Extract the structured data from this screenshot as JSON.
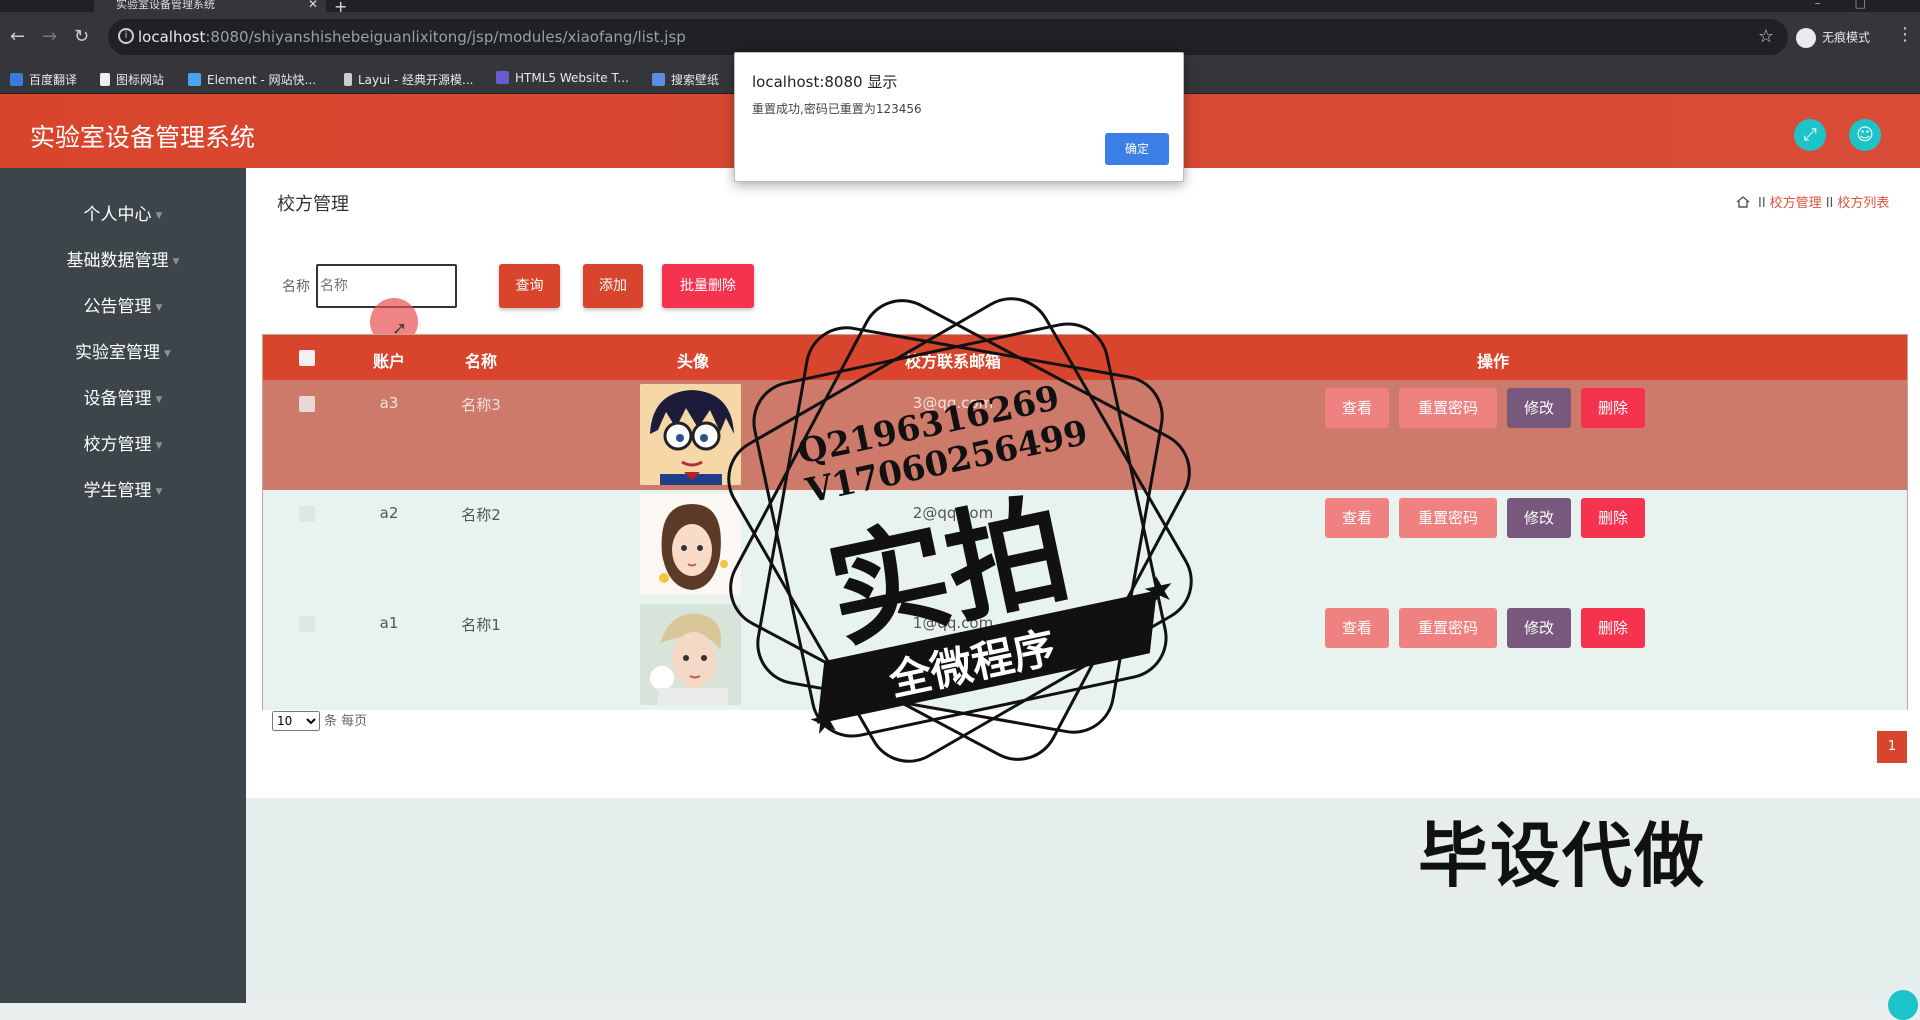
{
  "browser": {
    "tab_title": "实验室设备管理系统",
    "new_tab": "+",
    "url_host": "localhost",
    "url_rest": ":8080/shiyanshishebeiguanlixitong/jsp/modules/xiaofang/list.jsp",
    "incognito_label": "无痕模式",
    "bookmarks": [
      "百度翻译",
      "图标网站",
      "Element - 网站快...",
      "Layui - 经典开源模...",
      "HTML5 Website T...",
      "搜索壁纸"
    ]
  },
  "alert": {
    "title": "localhost:8080 显示",
    "message": "重置成功,密码已重置为123456",
    "ok_label": "确定"
  },
  "header": {
    "title": "实验室设备管理系统"
  },
  "sidebar": {
    "items": [
      "个人中心",
      "基础数据管理",
      "公告管理",
      "实验室管理",
      "设备管理",
      "校方管理",
      "学生管理"
    ]
  },
  "page": {
    "title": "校方管理",
    "breadcrumb": [
      "校方管理",
      "校方列表"
    ]
  },
  "search": {
    "label": "名称",
    "placeholder": "名称",
    "query_label": "查询",
    "add_label": "添加",
    "bulk_delete_label": "批量删除"
  },
  "table": {
    "headers": [
      "账户",
      "名称",
      "头像",
      "校方联系邮箱",
      "操作"
    ],
    "rows": [
      {
        "account": "a3",
        "name": "名称3",
        "email": "3@qq.com"
      },
      {
        "account": "a2",
        "name": "名称2",
        "email": "2@qq.com"
      },
      {
        "account": "a1",
        "name": "名称1",
        "email": "1@qq.com"
      }
    ],
    "actions": {
      "view": "查看",
      "reset": "重置密码",
      "edit": "修改",
      "delete": "删除"
    }
  },
  "pagination": {
    "page_size": "10",
    "per_page_text": "条 每页",
    "current_page": "1"
  },
  "watermark": {
    "contact1": "Q2196316269",
    "contact2": "V17060256499",
    "big": "实拍",
    "ribbon": "全微程序",
    "bottom": "毕设代做"
  },
  "colors": {
    "primary": "#d9452c",
    "sidebar": "#3c4549",
    "accent_teal": "#1cc3c9",
    "danger": "#f5334f",
    "edit": "#79587d",
    "soft_red": "#ef8181"
  }
}
